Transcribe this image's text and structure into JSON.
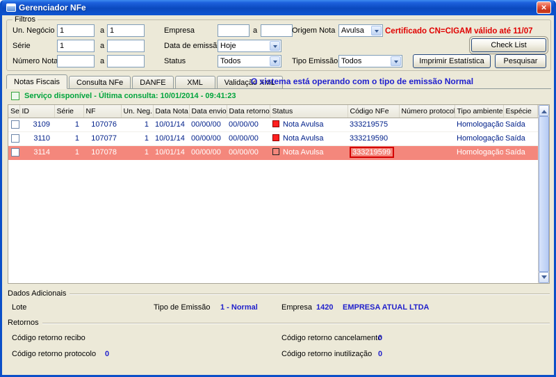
{
  "window": {
    "title": "Gerenciador NFe",
    "close_glyph": "×"
  },
  "colors": {
    "selected_row": "#F4877C",
    "alert_red": "#D40000",
    "value_blue": "#2121CC",
    "success_green": "#00A43C",
    "message_blue": "#2020CE",
    "cert_red": "#E00000"
  },
  "filters": {
    "group_label": "Filtros",
    "a_label": "a",
    "un_negocio_label": "Un. Negócio",
    "un_negocio_from": "1",
    "un_negocio_to": "1",
    "serie_label": "Série",
    "serie_from": "1",
    "serie_to": "",
    "numero_nota_label": "Número Nota",
    "numero_nota_from": "",
    "numero_nota_to": "",
    "empresa_label": "Empresa",
    "empresa_from": "",
    "empresa_to": "",
    "data_emissao_label": "Data de emissão",
    "data_emissao_value": "Hoje",
    "status_label": "Status",
    "status_value": "Todos",
    "origem_label": "Origem Nota",
    "origem_value": "Avulsa",
    "tipo_emissao_label": "Tipo Emissão",
    "tipo_emissao_value": "Todos",
    "certificado": "Certificado CN=CIGAM válido até 11/07",
    "check_list": "Check List",
    "imprimir_estatistica": "Imprimir Estatística",
    "pesquisar": "Pesquisar"
  },
  "tabs": [
    {
      "label": "Notas Fiscais",
      "active": true
    },
    {
      "label": "Consulta NFe"
    },
    {
      "label": "DANFE"
    },
    {
      "label": "XML"
    },
    {
      "label": "Validação XML"
    }
  ],
  "messages": {
    "emissao": "O sistema está operando com o tipo de emissão Normal",
    "servico": "Serviço disponível - Última consulta: 10/01/2014 - 09:41:23"
  },
  "table": {
    "columns": [
      "Sel",
      "ID",
      "Série",
      "NF",
      "Un. Neg.",
      "Data Nota",
      "Data envio",
      "Data retorno",
      "Status",
      "Código NFe",
      "Número protocolo",
      "Tipo ambiente",
      "Espécie"
    ],
    "rows": [
      {
        "id": "3109",
        "serie": "1",
        "nf": "107076",
        "un_neg": "1",
        "data_nota": "10/01/14",
        "data_envio": "00/00/00",
        "data_retorno": "00/00/00",
        "status": "Nota Avulsa",
        "status_icon": "red",
        "codigo_nfe": "333219575",
        "protocolo": "",
        "tipo_ambiente": "Homologação",
        "especie": "Saída",
        "selected": false,
        "highlight": false
      },
      {
        "id": "3110",
        "serie": "1",
        "nf": "107077",
        "un_neg": "1",
        "data_nota": "10/01/14",
        "data_envio": "00/00/00",
        "data_retorno": "00/00/00",
        "status": "Nota Avulsa",
        "status_icon": "red",
        "codigo_nfe": "333219590",
        "protocolo": "",
        "tipo_ambiente": "Homologação",
        "especie": "Saída",
        "selected": false,
        "highlight": false
      },
      {
        "id": "3114",
        "serie": "1",
        "nf": "107078",
        "un_neg": "1",
        "data_nota": "10/01/14",
        "data_envio": "00/00/00",
        "data_retorno": "00/00/00",
        "status": "Nota Avulsa",
        "status_icon": "dark",
        "codigo_nfe": "333219599",
        "protocolo": "",
        "tipo_ambiente": "Homologação",
        "especie": "Saída",
        "selected": true,
        "highlight": true
      }
    ]
  },
  "dados": {
    "title": "Dados Adicionais",
    "lote_label": "Lote",
    "tipo_emissao_label": "Tipo de Emissão",
    "tipo_emissao_value": "1 - Normal",
    "empresa_label": "Empresa",
    "empresa_codigo": "1420",
    "empresa_nome": "EMPRESA ATUAL LTDA"
  },
  "retornos": {
    "title": "Retornos",
    "recibo_label": "Código retorno recibo",
    "recibo_value": "",
    "protocolo_label": "Código retorno protocolo",
    "protocolo_value": "0",
    "cancelamento_label": "Código retorno cancelamento",
    "cancelamento_value": "0",
    "inutilizacao_label": "Código retorno inutilização",
    "inutilizacao_value": "0"
  }
}
